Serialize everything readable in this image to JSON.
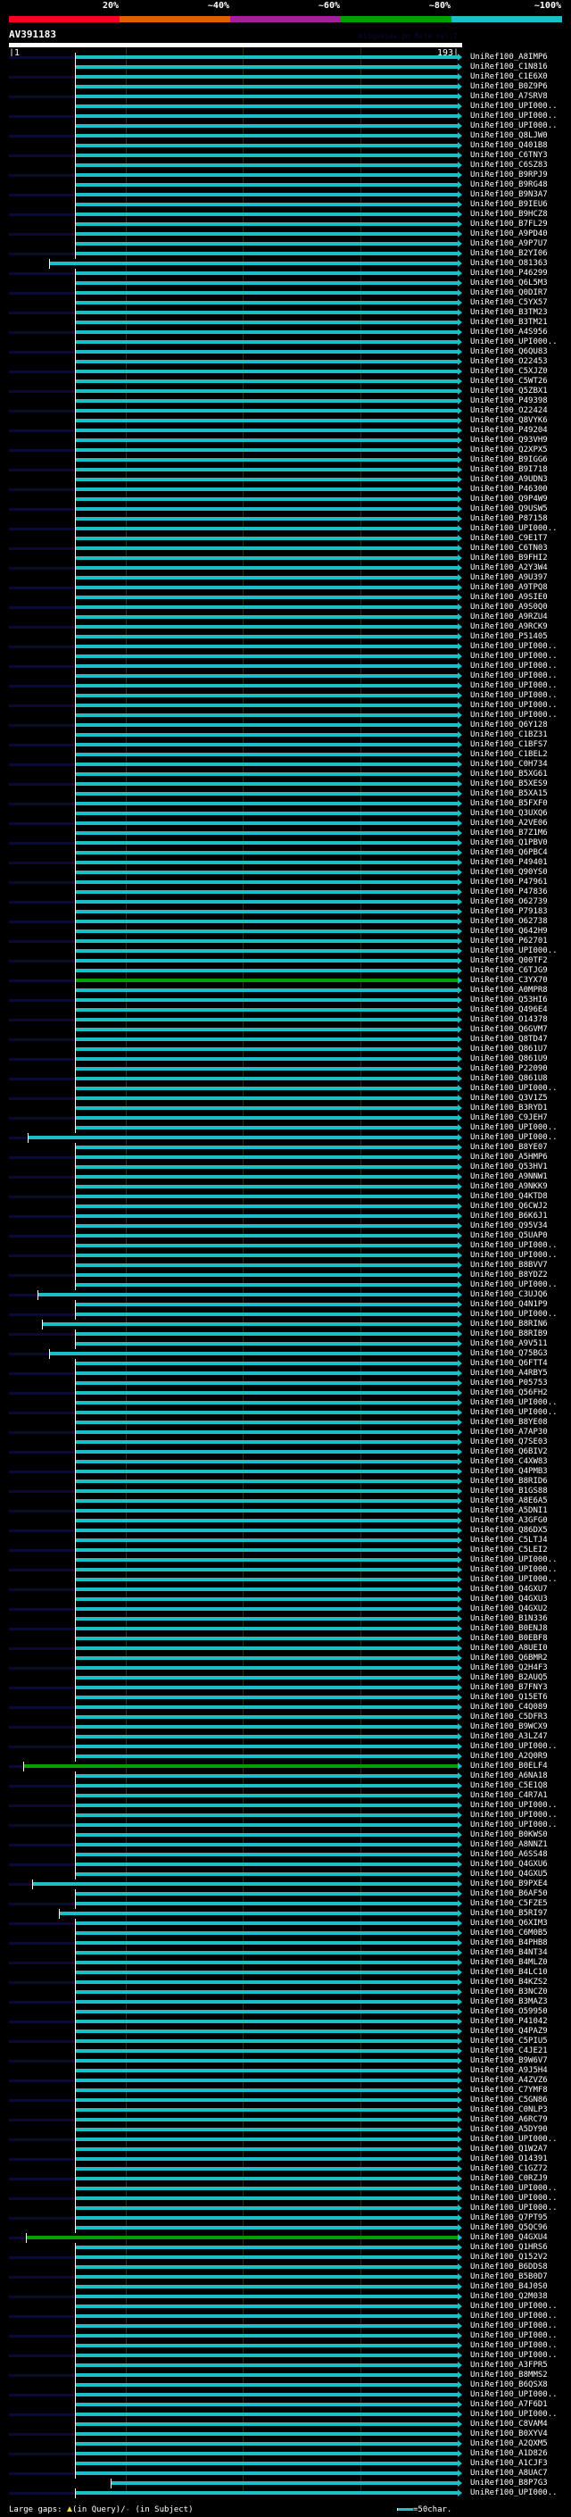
{
  "header": {
    "percent_labels": [
      "20%",
      "~40%",
      "~60%",
      "~80%",
      "~100%"
    ],
    "percent_colors": [
      "#ff0022",
      "#e06000",
      "#a020a0",
      "#00a000",
      "#1ac0c6"
    ],
    "query_id": "AV391183",
    "credit": "AlignView.pm Beta rel.7",
    "ruler_start": "|1",
    "ruler_end": "193|",
    "query_length": 193
  },
  "colors": {
    "hit": "#1ac0c6",
    "green_hit": "#00a000",
    "navy": "#0a0a3a"
  },
  "default_start": 29,
  "hit_exceptions": [
    {
      "index": 21,
      "start": 18
    },
    {
      "index": 94,
      "color": "green"
    },
    {
      "index": 110,
      "start": 9
    },
    {
      "index": 126,
      "start": 13
    },
    {
      "index": 129,
      "start": 15
    },
    {
      "index": 132,
      "start": 18
    },
    {
      "index": 174,
      "start": 7,
      "color": "green"
    },
    {
      "index": 186,
      "start": 11
    },
    {
      "index": 189,
      "start": 22
    },
    {
      "index": 222,
      "start": 8,
      "color": "green"
    },
    {
      "index": 247,
      "start": 44
    }
  ],
  "hits": [
    "UniRef100_A8IMP6",
    "UniRef100_C1N816",
    "UniRef100_C1E6X0",
    "UniRef100_B0Z9P6",
    "UniRef100_A7SRV8",
    "UniRef100_UPI000..",
    "UniRef100_UPI000..",
    "UniRef100_UPI000..",
    "UniRef100_Q8LJW0",
    "UniRef100_Q401B8",
    "UniRef100_C6TNY3",
    "UniRef100_C6SZ83",
    "UniRef100_B9RPJ9",
    "UniRef100_B9RG48",
    "UniRef100_B9N3A7",
    "UniRef100_B9IEU6",
    "UniRef100_B9HCZ8",
    "UniRef100_B7FL29",
    "UniRef100_A9PD40",
    "UniRef100_A9P7U7",
    "UniRef100_B2YI06",
    "UniRef100_O81363",
    "UniRef100_P46299",
    "UniRef100_Q6L5M3",
    "UniRef100_Q0DIR7",
    "UniRef100_C5YX57",
    "UniRef100_B3TM23",
    "UniRef100_B3TM21",
    "UniRef100_A4S956",
    "UniRef100_UPI000..",
    "UniRef100_Q6QU83",
    "UniRef100_O22453",
    "UniRef100_C5XJZ0",
    "UniRef100_C5WT26",
    "UniRef100_Q5ZBX1",
    "UniRef100_P49398",
    "UniRef100_O22424",
    "UniRef100_Q8VYK6",
    "UniRef100_P49204",
    "UniRef100_Q93VH9",
    "UniRef100_Q2XPX5",
    "UniRef100_B9IGG6",
    "UniRef100_B9I718",
    "UniRef100_A9UDN3",
    "UniRef100_P46300",
    "UniRef100_Q9P4W9",
    "UniRef100_Q9USW5",
    "UniRef100_P87158",
    "UniRef100_UPI000..",
    "UniRef100_C9E1T7",
    "UniRef100_C6TN03",
    "UniRef100_B9FHI2",
    "UniRef100_A2Y3W4",
    "UniRef100_A9U397",
    "UniRef100_A9TPQ8",
    "UniRef100_A9SIE0",
    "UniRef100_A9S0Q0",
    "UniRef100_A9RZU4",
    "UniRef100_A9RCK9",
    "UniRef100_P51405",
    "UniRef100_UPI000..",
    "UniRef100_UPI000..",
    "UniRef100_UPI000..",
    "UniRef100_UPI000..",
    "UniRef100_UPI000..",
    "UniRef100_UPI000..",
    "UniRef100_UPI000..",
    "UniRef100_UPI000..",
    "UniRef100_Q6Y128",
    "UniRef100_C1BZ31",
    "UniRef100_C1BFS7",
    "UniRef100_C1BEL2",
    "UniRef100_C0H734",
    "UniRef100_B5XG61",
    "UniRef100_B5XES9",
    "UniRef100_B5XA15",
    "UniRef100_B5FXF0",
    "UniRef100_Q3UXQ6",
    "UniRef100_A2VE06",
    "UniRef100_B7Z1M6",
    "UniRef100_Q1PBV0",
    "UniRef100_Q6PBC4",
    "UniRef100_P49401",
    "UniRef100_Q90YS0",
    "UniRef100_P47961",
    "UniRef100_P47836",
    "UniRef100_O62739",
    "UniRef100_P79183",
    "UniRef100_O62738",
    "UniRef100_Q642H9",
    "UniRef100_P62701",
    "UniRef100_UPI000..",
    "UniRef100_Q00TF2",
    "UniRef100_C6TJG9",
    "UniRef100_C3YX70",
    "UniRef100_A0MPR8",
    "UniRef100_Q53HI6",
    "UniRef100_Q496E4",
    "UniRef100_O14378",
    "UniRef100_Q6GVM7",
    "UniRef100_Q8TD47",
    "UniRef100_Q861U7",
    "UniRef100_Q861U9",
    "UniRef100_P22090",
    "UniRef100_Q861U8",
    "UniRef100_UPI000..",
    "UniRef100_Q3V1Z5",
    "UniRef100_B3RYD1",
    "UniRef100_C9JEH7",
    "UniRef100_UPI000..",
    "UniRef100_UPI000..",
    "UniRef100_B8YE07",
    "UniRef100_A5HMP6",
    "UniRef100_Q53HV1",
    "UniRef100_A9NNW1",
    "UniRef100_A9NKK9",
    "UniRef100_Q4KTD8",
    "UniRef100_Q6CWJ2",
    "UniRef100_B6K6J1",
    "UniRef100_Q95V34",
    "UniRef100_Q5UAP0",
    "UniRef100_UPI000..",
    "UniRef100_UPI000..",
    "UniRef100_B8BVV7",
    "UniRef100_B8YDZ2",
    "UniRef100_UPI000..",
    "UniRef100_C3UJQ6",
    "UniRef100_Q4N1P9",
    "UniRef100_UPI000..",
    "UniRef100_B8RIN6",
    "UniRef100_B8RIB9",
    "UniRef100_A9V511",
    "UniRef100_Q75BG3",
    "UniRef100_Q6FTT4",
    "UniRef100_A4RBY5",
    "UniRef100_P05753",
    "UniRef100_Q56FH2",
    "UniRef100_UPI000..",
    "UniRef100_UPI000..",
    "UniRef100_B8YE08",
    "UniRef100_A7AP30",
    "UniRef100_Q7SE03",
    "UniRef100_Q6BIV2",
    "UniRef100_C4XW83",
    "UniRef100_Q4PMB3",
    "UniRef100_B8RID6",
    "UniRef100_B1GS88",
    "UniRef100_A8E6A5",
    "UniRef100_A5DNI1",
    "UniRef100_A3GFG0",
    "UniRef100_Q86DX5",
    "UniRef100_C5LTJ4",
    "UniRef100_C5LEI2",
    "UniRef100_UPI000..",
    "UniRef100_UPI000..",
    "UniRef100_UPI000..",
    "UniRef100_Q4GXU7",
    "UniRef100_Q4GXU3",
    "UniRef100_Q4GXU2",
    "UniRef100_B1N336",
    "UniRef100_B0ENJ8",
    "UniRef100_B0EBF8",
    "UniRef100_A8UEI0",
    "UniRef100_Q6BMR2",
    "UniRef100_Q2H4F3",
    "UniRef100_B2AUQ5",
    "UniRef100_B7FNY3",
    "UniRef100_Q15ET6",
    "UniRef100_C4Q089",
    "UniRef100_C5DFR3",
    "UniRef100_B9WCX9",
    "UniRef100_A3LZ47",
    "UniRef100_UPI000..",
    "UniRef100_A2Q0R9",
    "UniRef100_B0ELF4",
    "UniRef100_A6NA18",
    "UniRef100_C5E1Q8",
    "UniRef100_C4R7A1",
    "UniRef100_UPI000..",
    "UniRef100_UPI000..",
    "UniRef100_UPI000..",
    "UniRef100_B0KWS0",
    "UniRef100_A8NNZ1",
    "UniRef100_A6SS48",
    "UniRef100_Q4GXU6",
    "UniRef100_Q4GXU5",
    "UniRef100_B9PXE4",
    "UniRef100_B6AF50",
    "UniRef100_C5FZE5",
    "UniRef100_B5RI97",
    "UniRef100_Q6XIM3",
    "UniRef100_C6M0B5",
    "UniRef100_B4PHB8",
    "UniRef100_B4NT34",
    "UniRef100_B4MLZ0",
    "UniRef100_B4LC10",
    "UniRef100_B4KZS2",
    "UniRef100_B3NCZ0",
    "UniRef100_B3MAZ3",
    "UniRef100_O59950",
    "UniRef100_P41042",
    "UniRef100_Q4PAZ9",
    "UniRef100_C5PIU5",
    "UniRef100_C4JE21",
    "UniRef100_B9W6V7",
    "UniRef100_A9J5H4",
    "UniRef100_A4ZVZ6",
    "UniRef100_C7YMF8",
    "UniRef100_C5GN86",
    "UniRef100_C0NLP3",
    "UniRef100_A6RC79",
    "UniRef100_A5DY90",
    "UniRef100_UPI000..",
    "UniRef100_Q1W2A7",
    "UniRef100_O14391",
    "UniRef100_C1GZ72",
    "UniRef100_C0RZJ9",
    "UniRef100_UPI000..",
    "UniRef100_UPI000..",
    "UniRef100_UPI000..",
    "UniRef100_Q7PT95",
    "UniRef100_Q5QC96",
    "UniRef100_Q4GXU4",
    "UniRef100_Q1HRS6",
    "UniRef100_Q152V2",
    "UniRef100_B6DDS8",
    "UniRef100_B5B0D7",
    "UniRef100_B4J0S0",
    "UniRef100_Q2M038",
    "UniRef100_UPI000..",
    "UniRef100_UPI000..",
    "UniRef100_UPI000..",
    "UniRef100_UPI000..",
    "UniRef100_UPI000..",
    "UniRef100_UPI000..",
    "UniRef100_A3FPR5",
    "UniRef100_B8MMS2",
    "UniRef100_B6QSX8",
    "UniRef100_UPI000..",
    "UniRef100_A7F6D1",
    "UniRef100_UPI000..",
    "UniRef100_C8VAM4",
    "UniRef100_B0XYV4",
    "UniRef100_A2QXM5",
    "UniRef100_A1D826",
    "UniRef100_A1CJF3",
    "UniRef100_A8UAC7",
    "UniRef100_B8P7G3",
    "UniRef100_UPI000.."
  ],
  "footer": {
    "gaps_label": "Large gaps:",
    "in_query": "(in Query)/",
    "subject_mark": "-",
    "in_subject": "(in Subject)",
    "scale_label": "=50char."
  }
}
